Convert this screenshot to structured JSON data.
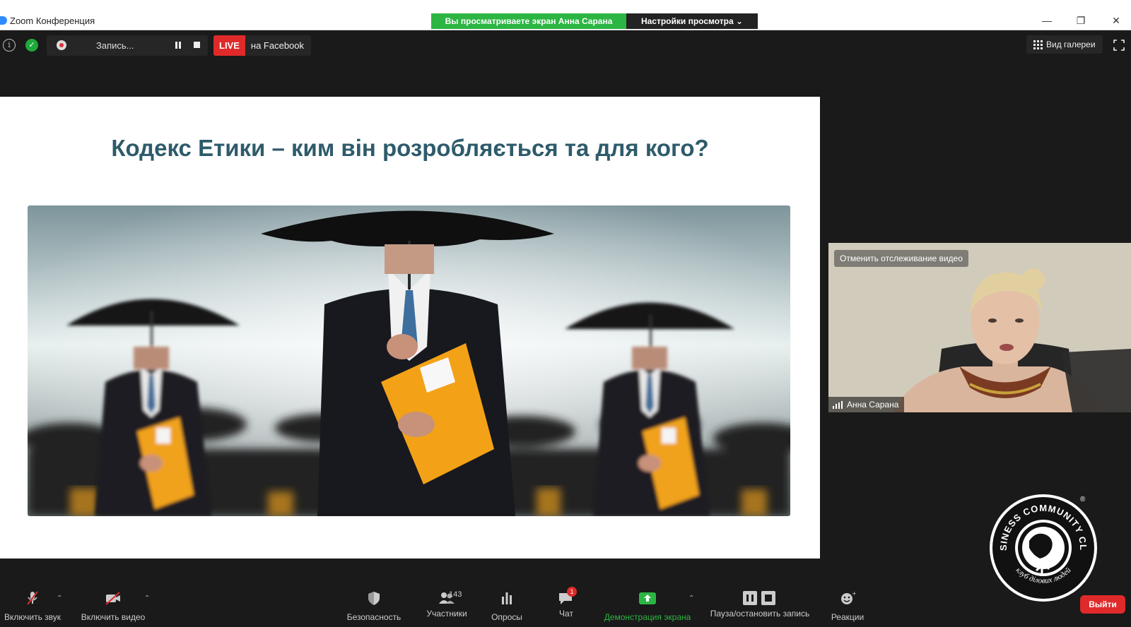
{
  "window": {
    "title": "Zoom Конференция",
    "share_banner": "Вы просматриваете экран Анна Сарана",
    "view_options": "Настройки просмотра ⌄"
  },
  "topbar": {
    "recording_label": "Запись...",
    "live_badge": "LIVE",
    "live_target": "на Facebook",
    "gallery_view": "Вид галереи"
  },
  "slide": {
    "title": "Кодекс Етики – ким він розробляється та для кого?"
  },
  "participant": {
    "unpin_label": "Отменить отслеживание видео",
    "name": "Анна Сарана"
  },
  "toolbar": {
    "mute_label": "Включить звук",
    "video_label": "Включить видео",
    "security_label": "Безопасность",
    "participants_label": "Участники",
    "participants_count": "143",
    "polls_label": "Опросы",
    "chat_label": "Чат",
    "chat_badge": "1",
    "share_label": "Демонстрация экрана",
    "record_label": "Пауза/остановить запись",
    "reactions_label": "Реакции",
    "leave_label": "Выйти"
  },
  "logo": {
    "top_text": "BUSINESS COMMUNITY CLUB",
    "bottom_text": "клуб ділових людей",
    "mark": "®"
  },
  "colors": {
    "share_green": "#2cb543",
    "live_red": "#e02a2a",
    "slide_title": "#2e5b6b"
  }
}
